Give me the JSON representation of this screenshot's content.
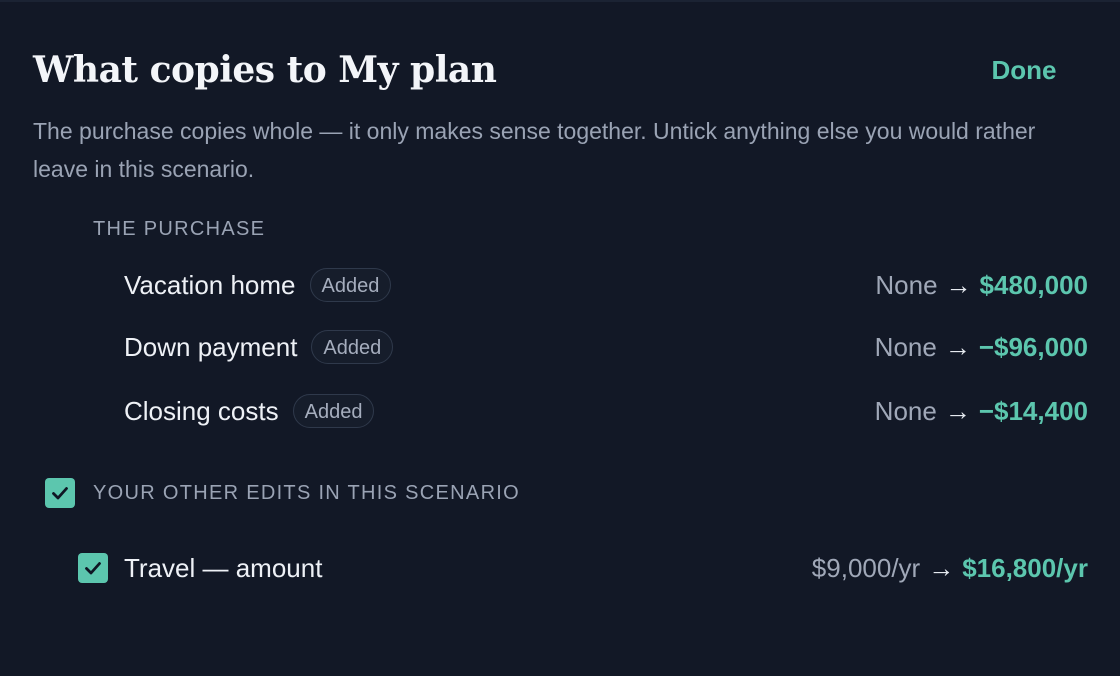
{
  "dialog": {
    "title": "What copies to My plan",
    "done_label": "Done",
    "description": "The purchase copies whole — it only makes sense together. Untick anything else you would rather leave in this scenario."
  },
  "purchase": {
    "heading": "THE PURCHASE",
    "items": [
      {
        "label": "Vacation home",
        "badge": "Added",
        "old_value": "None",
        "arrow": "→",
        "new_value": "$480,000"
      },
      {
        "label": "Down payment",
        "badge": "Added",
        "old_value": "None",
        "arrow": "→",
        "new_value": "−$96,000"
      },
      {
        "label": "Closing costs",
        "badge": "Added",
        "old_value": "None",
        "arrow": "→",
        "new_value": "−$14,400"
      }
    ]
  },
  "other_edits": {
    "heading": "YOUR OTHER EDITS IN THIS SCENARIO",
    "checked": true,
    "items": [
      {
        "label": "Travel — amount",
        "checked": true,
        "old_value": "$9,000/yr",
        "arrow": "→",
        "new_value": "$16,800/yr"
      }
    ]
  },
  "colors": {
    "background": "#121826",
    "accent": "#5cc6ae",
    "muted_text": "#9aa3b4",
    "primary_text": "#eef1f6"
  },
  "icons": {
    "checkbox": "checkmark-icon",
    "arrow": "right-arrow"
  }
}
